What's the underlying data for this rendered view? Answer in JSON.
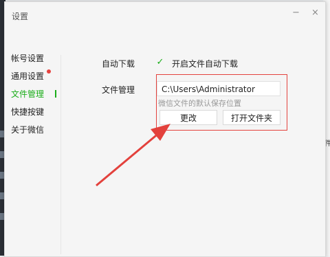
{
  "window": {
    "title": "设置"
  },
  "controls": {
    "minimize": "−",
    "close": "×"
  },
  "sidebar": {
    "items": [
      {
        "label": "帐号设置"
      },
      {
        "label": "通用设置"
      },
      {
        "label": "文件管理"
      },
      {
        "label": "快捷按键"
      },
      {
        "label": "关于微信"
      }
    ]
  },
  "settings": {
    "auto_download_label": "自动下载",
    "auto_download_checkbox_label": "开启文件自动下载",
    "checkbox_mark": "✓",
    "file_management_label": "文件管理",
    "path_value": "C:\\Users\\Administrator",
    "default_path_hint": "微信文件的默认保存位置",
    "change_button": "更改",
    "open_folder_button": "打开文件夹"
  },
  "background": {
    "right_fragment": "件"
  },
  "colors": {
    "accent": "#1aad19",
    "annotation": "#e3413c",
    "badge": "#e64340"
  }
}
